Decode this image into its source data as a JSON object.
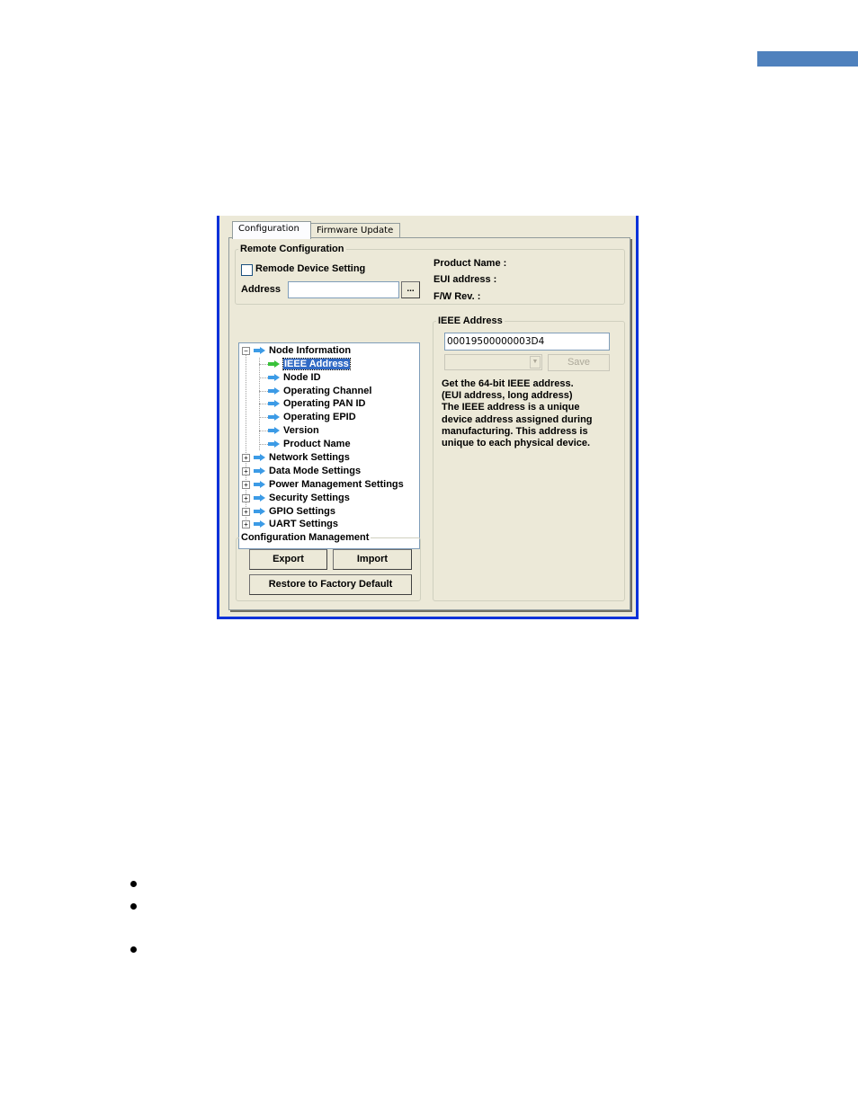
{
  "page": {
    "header_bar_color": "#4f81bd",
    "bullets": [
      {
        "text": ""
      },
      {
        "text": ""
      },
      {
        "text": ""
      }
    ]
  },
  "window": {
    "border_color": "#0831d9",
    "tabs": [
      {
        "label": "Configuration",
        "active": true
      },
      {
        "label": "Firmware Update",
        "active": false
      }
    ],
    "remote_configuration": {
      "title": "Remote Configuration",
      "checkbox_label": "Remode Device Setting",
      "checked": false,
      "address_label": "Address",
      "address_value": "",
      "browse_label": "...",
      "info": {
        "product_name_label": "Product Name :",
        "eui_address_label": "EUI address :",
        "fw_rev_label": "F/W Rev. :"
      }
    },
    "tree": {
      "root": {
        "label": "Node Information",
        "expanded": true,
        "children": [
          {
            "label": "IEEE Address",
            "selected": true
          },
          {
            "label": "Node ID"
          },
          {
            "label": "Operating Channel"
          },
          {
            "label": "Operating PAN ID"
          },
          {
            "label": "Operating EPID"
          },
          {
            "label": "Version"
          },
          {
            "label": "Product Name"
          }
        ]
      },
      "groups": [
        {
          "label": "Network Settings"
        },
        {
          "label": "Data Mode Settings"
        },
        {
          "label": "Power Management Settings"
        },
        {
          "label": "Security Settings"
        },
        {
          "label": "GPIO Settings"
        },
        {
          "label": "UART Settings"
        }
      ]
    },
    "config_management": {
      "title": "Configuration Management",
      "export_label": "Export",
      "import_label": "Import",
      "restore_label": "Restore to Factory Default"
    },
    "detail": {
      "title": "IEEE Address",
      "value": "00019500000003D4",
      "combo_value": "",
      "save_label": "Save",
      "description": [
        "Get the 64-bit IEEE address.",
        "(EUI address, long address)",
        "The IEEE address is a unique",
        "device address assigned during",
        "manufacturing. This address is",
        "unique to each physical device."
      ]
    }
  }
}
